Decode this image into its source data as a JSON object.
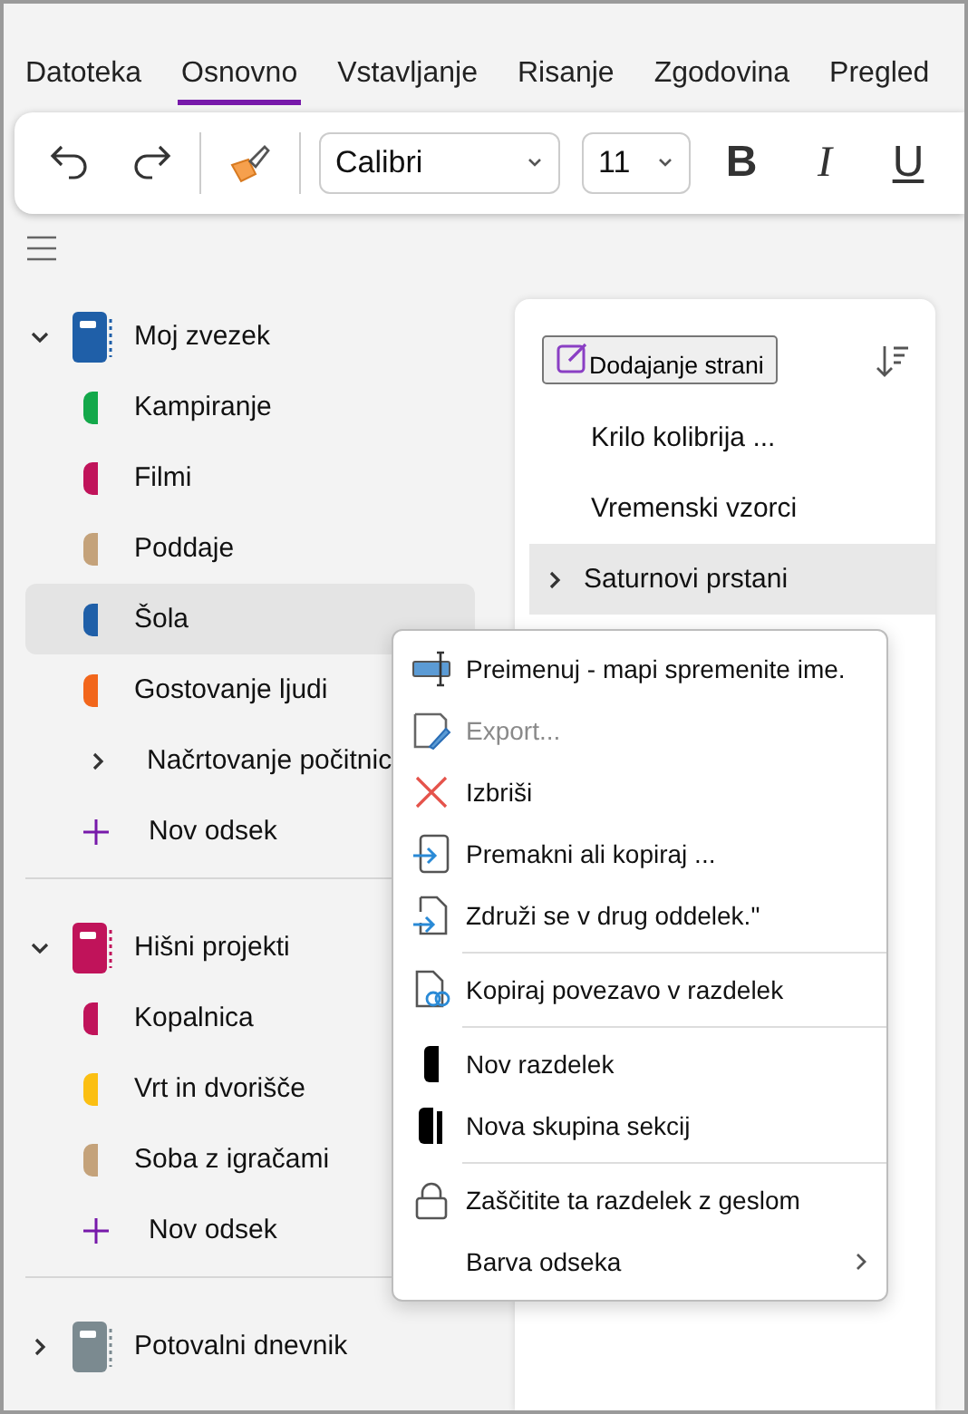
{
  "tabs": [
    {
      "label": "Datoteka",
      "selected": false
    },
    {
      "label": "Osnovno",
      "selected": true
    },
    {
      "label": "Vstavljanje",
      "selected": false
    },
    {
      "label": "Risanje",
      "selected": false
    },
    {
      "label": "Zgodovina",
      "selected": false
    },
    {
      "label": "Pregled",
      "selected": false
    }
  ],
  "toolbar": {
    "font": "Calibri",
    "size": "11",
    "format_buttons": [
      {
        "label": "B",
        "kind": "bold"
      },
      {
        "label": "I",
        "kind": "italic"
      },
      {
        "label": "U",
        "kind": "underline"
      }
    ]
  },
  "notebooks": [
    {
      "name": "Moj zvezek",
      "color": "#1f5fa8",
      "expanded": true,
      "add_label": "Nov odsek",
      "sections": [
        {
          "name": "Kampiranje",
          "kind": "section",
          "color": "#13a84a",
          "selected": false
        },
        {
          "name": "Filmi",
          "kind": "section",
          "color": "#c0135a",
          "selected": false
        },
        {
          "name": "Poddaje",
          "kind": "section",
          "color": "#c4a27a",
          "selected": false
        },
        {
          "name": "Šola",
          "kind": "section",
          "color": "#1f5fa8",
          "selected": true
        },
        {
          "name": "Gostovanje ljudi",
          "kind": "section",
          "color": "#f2661b",
          "selected": false
        },
        {
          "name": "Načrtovanje počitnic",
          "kind": "group",
          "expanded": false,
          "selected": false
        }
      ]
    },
    {
      "name": "Hišni projekti",
      "color": "#c0135a",
      "expanded": true,
      "add_label": "Nov odsek",
      "sections": [
        {
          "name": "Kopalnica",
          "kind": "section",
          "color": "#c0135a",
          "selected": false
        },
        {
          "name": "Vrt in dvorišče",
          "kind": "section",
          "color": "#fbbf12",
          "selected": false
        },
        {
          "name": "Soba z igračami",
          "kind": "section",
          "color": "#c4a27a",
          "selected": false
        }
      ]
    },
    {
      "name": "Potovalni dnevnik",
      "color": "#7b8a90",
      "expanded": false
    }
  ],
  "pages": {
    "add_label": "Dodajanje strani",
    "items": [
      {
        "title": "Krilo kolibrija ...",
        "selected": false,
        "has_subpages": false
      },
      {
        "title": "Vremenski vzorci",
        "selected": false,
        "has_subpages": false
      },
      {
        "title": "Saturnovi prstani",
        "selected": true,
        "has_subpages": true
      }
    ]
  },
  "context_menu": {
    "groups": [
      [
        {
          "label": "Preimenuj - mapi spremenite ime.",
          "kind": "rename",
          "disabled": false,
          "submenu": false
        },
        {
          "label": "Export...",
          "kind": "export",
          "disabled": true,
          "submenu": false
        },
        {
          "label": "Izbriši",
          "kind": "delete",
          "disabled": false,
          "submenu": false
        },
        {
          "label": "Premakni ali kopiraj ...",
          "kind": "move",
          "disabled": false,
          "submenu": false
        },
        {
          "label": "Združi se v drug oddelek.\"",
          "kind": "merge",
          "disabled": false,
          "submenu": false
        }
      ],
      [
        {
          "label": "Kopiraj povezavo v razdelek",
          "kind": "link",
          "disabled": false,
          "submenu": false
        }
      ],
      [
        {
          "label": "Nov razdelek",
          "kind": "new-section",
          "disabled": false,
          "submenu": false
        },
        {
          "label": "Nova skupina sekcij",
          "kind": "new-group",
          "disabled": false,
          "submenu": false
        }
      ],
      [
        {
          "label": "Zaščitite ta razdelek z geslom",
          "kind": "lock",
          "disabled": false,
          "submenu": false
        },
        {
          "label": "Barva odseka",
          "kind": "color",
          "disabled": false,
          "submenu": true
        }
      ]
    ]
  }
}
